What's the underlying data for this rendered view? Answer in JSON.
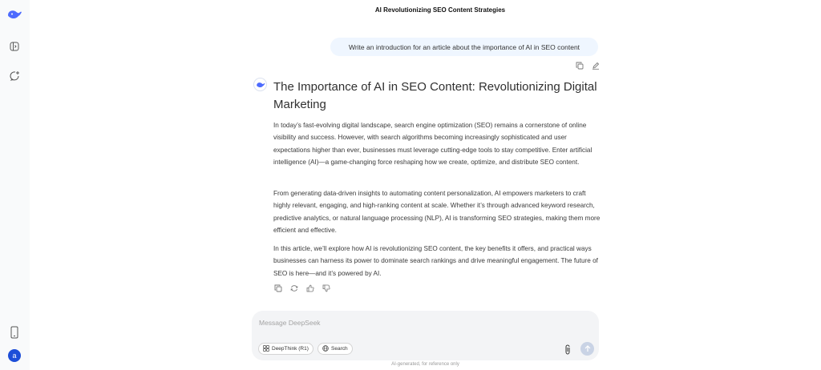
{
  "app": {
    "title": "AI Revolutionizing SEO Content Strategies",
    "brand_color": "#4d6bfe"
  },
  "sidebar": {
    "icons": [
      "whale-logo-icon",
      "open-sidebar-icon",
      "new-chat-icon",
      "mobile-app-icon"
    ],
    "avatar_letter": "a"
  },
  "conversation": {
    "user_message": "Write an introduction for an article about the importance of AI in SEO content",
    "user_actions": [
      "copy-icon",
      "edit-icon"
    ],
    "response": {
      "heading": "The Importance of AI in SEO Content: Revolutionizing Digital Marketing",
      "paragraphs": [
        "In today’s fast-evolving digital landscape, search engine optimization (SEO) remains a cornerstone of online visibility and success. However, with search algorithms becoming increasingly sophisticated and user expectations higher than ever, businesses must leverage cutting-edge tools to stay competitive. Enter artificial intelligence (AI)—a game-changing force reshaping how we create, optimize, and distribute SEO content.",
        "From generating data-driven insights to automating content personalization, AI empowers marketers to craft highly relevant, engaging, and high-ranking content at scale. Whether it’s through advanced keyword research, predictive analytics, or natural language processing (NLP), AI is transforming SEO strategies, making them more efficient and effective.",
        "In this article, we’ll explore how AI is revolutionizing SEO content, the key benefits it offers, and practical ways businesses can harness its power to dominate search rankings and drive meaningful engagement. The future of SEO is here—and it’s powered by AI."
      ],
      "actions": [
        "copy-icon",
        "regenerate-icon",
        "thumbs-up-icon",
        "thumbs-down-icon"
      ]
    }
  },
  "composer": {
    "placeholder": "Message DeepSeek",
    "deepthink_label": "DeepThink (R1)",
    "search_label": "Search"
  },
  "footer": {
    "disclaimer": "AI-generated, for reference only"
  }
}
